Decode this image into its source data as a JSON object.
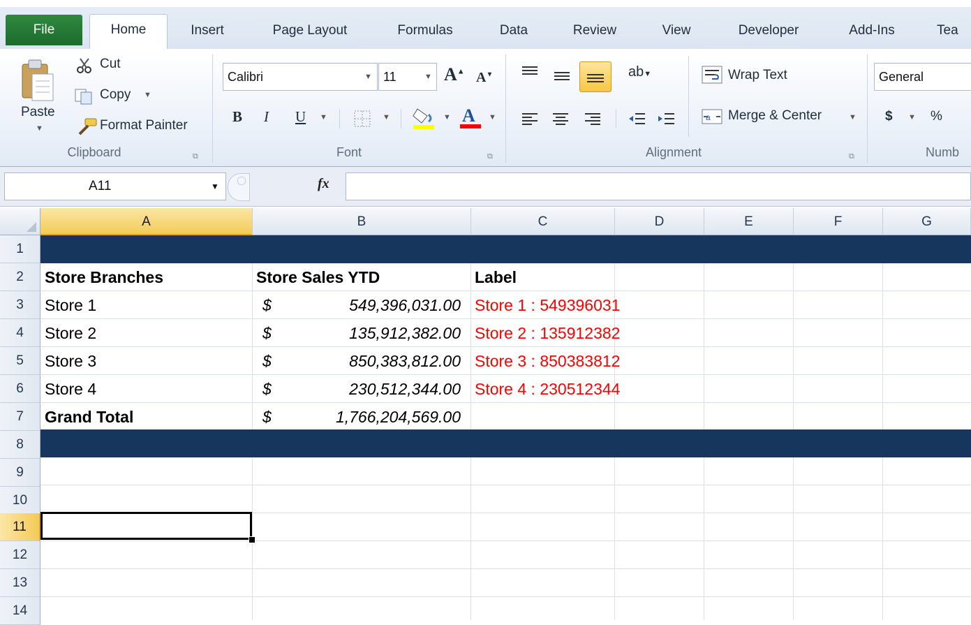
{
  "tabs": [
    "File",
    "Home",
    "Insert",
    "Page Layout",
    "Formulas",
    "Data",
    "Review",
    "View",
    "Developer",
    "Add-Ins",
    "Tea"
  ],
  "clipboard": {
    "paste": "Paste",
    "cut": "Cut",
    "copy": "Copy",
    "format_painter": "Format Painter",
    "group": "Clipboard"
  },
  "font": {
    "name": "Calibri",
    "size": "11",
    "group": "Font",
    "fill_color": "#ffff00",
    "text_color": "#ff0000"
  },
  "alignment": {
    "wrap_text": "Wrap Text",
    "merge_center": "Merge & Center",
    "group": "Alignment"
  },
  "number": {
    "format": "General",
    "currency": "$",
    "percent": "%",
    "group": "Numb"
  },
  "formula_bar": {
    "name_box": "A11",
    "fx": "fx",
    "value": ""
  },
  "grid": {
    "columns": [
      "A",
      "B",
      "C",
      "D",
      "E",
      "F",
      "G"
    ],
    "rows": [
      "1",
      "2",
      "3",
      "4",
      "5",
      "6",
      "7",
      "8",
      "9",
      "10",
      "11",
      "12",
      "13",
      "14"
    ],
    "band_color": "#17365d",
    "headers": {
      "a": "Store Branches",
      "b": "Store Sales YTD",
      "c": "Label"
    },
    "data": [
      {
        "store": "Store 1",
        "sign": "$",
        "sales": "549,396,031.00",
        "label": "Store 1 : 549396031"
      },
      {
        "store": "Store 2",
        "sign": "$",
        "sales": "135,912,382.00",
        "label": "Store 2 : 135912382"
      },
      {
        "store": "Store 3",
        "sign": "$",
        "sales": "850,383,812.00",
        "label": "Store 3 : 850383812"
      },
      {
        "store": "Store 4",
        "sign": "$",
        "sales": "230,512,344.00",
        "label": "Store 4 : 230512344"
      }
    ],
    "total": {
      "label": "Grand Total",
      "sign": "$",
      "sales": "1,766,204,569.00"
    },
    "selected_cell": "A11"
  }
}
